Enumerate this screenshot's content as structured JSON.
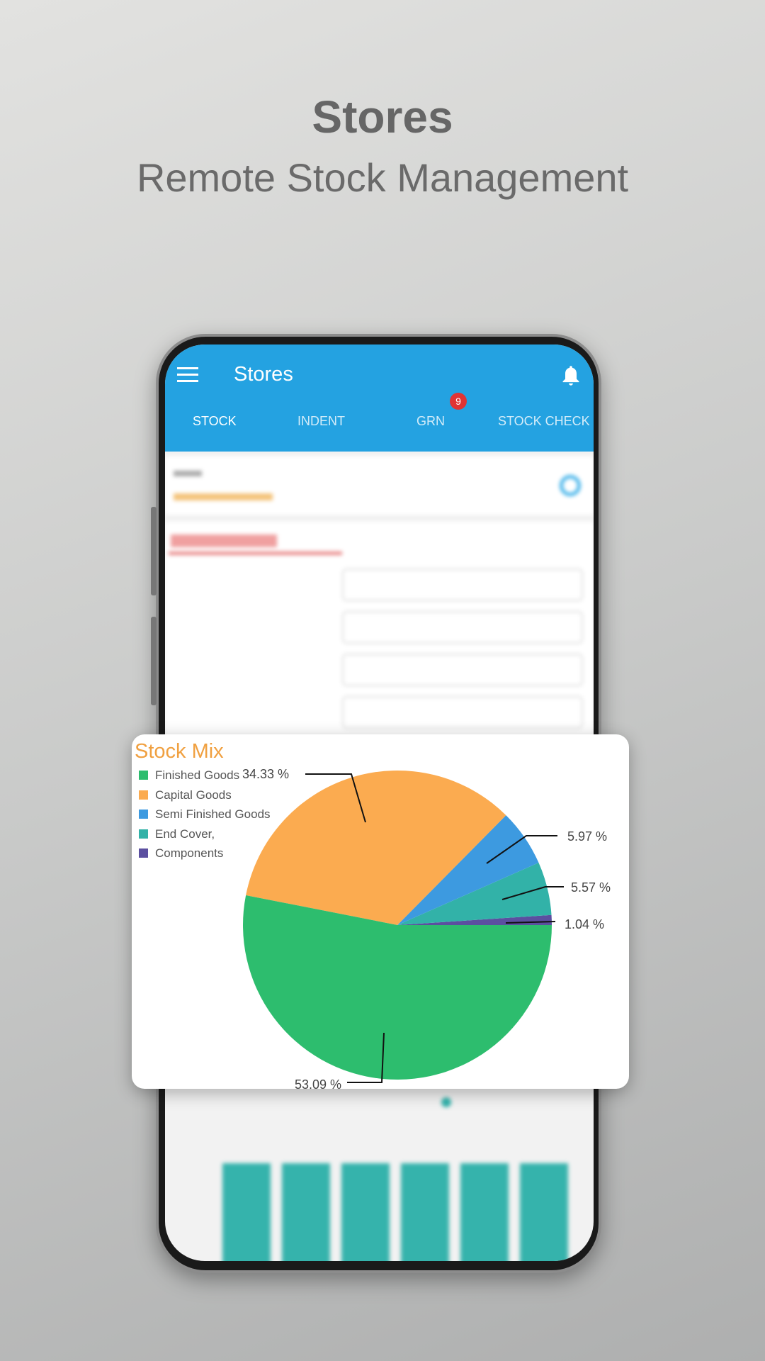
{
  "hero": {
    "title": "Stores",
    "subtitle": "Remote Stock Management"
  },
  "app": {
    "title": "Stores",
    "icons": {
      "menu": "hamburger-menu-icon",
      "notifications": "bell-icon",
      "refresh": "refresh-icon"
    },
    "accent": "#24a2e1",
    "tabs": [
      {
        "label": "STOCK",
        "active": true
      },
      {
        "label": "INDENT"
      },
      {
        "label": "GRN",
        "badge": "9"
      },
      {
        "label": "STOCK CHECK"
      }
    ]
  },
  "chart_data": {
    "type": "pie",
    "title": "Stock Mix",
    "legend_position": "top-left",
    "categories": [
      "Finished Goods",
      "Capital Goods",
      "Semi Finished Goods",
      "End Cover,",
      "Components"
    ],
    "values": [
      53.09,
      34.33,
      5.97,
      5.57,
      1.04
    ],
    "labels": [
      "53.09 %",
      "34.33 %",
      "5.97 %",
      "5.57 %",
      "1.04 %"
    ],
    "colors": [
      "#2dbd6e",
      "#fbab50",
      "#3d9ae0",
      "#32b2a8",
      "#5b4fa0"
    ]
  }
}
